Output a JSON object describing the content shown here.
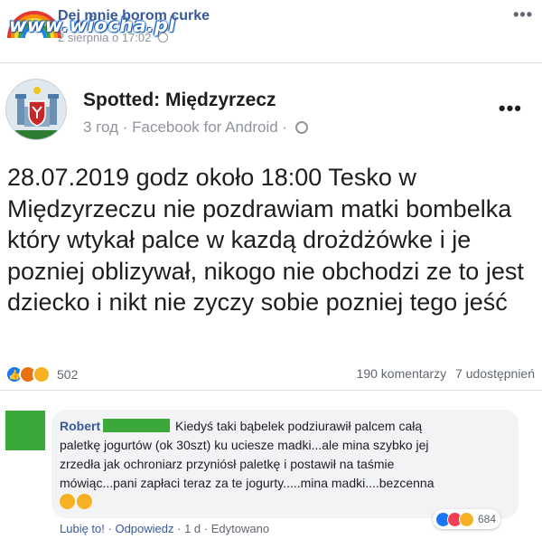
{
  "share": {
    "author": "Dej mnie borom curke",
    "date": "2 sierpnia o 17:02",
    "watermark": "www.wiocha.pl",
    "more_icon": "more-dots-icon"
  },
  "post": {
    "page_name": "Spotted: Międzyrzecz",
    "meta": "3 год · Facebook for Android ·",
    "text": "28.07.2019 godz około 18:00 Tesko w Międzyrzeczu nie pozdrawiam matki bombelka który wtykał palce w kazdą drożdżówke i je pozniej oblizywał, nikogo nie obchodzi ze to jest dziecko i nikt nie zyczy sobie pozniej tego jeść",
    "reactions_count": "502",
    "comments": "190 komentarzy",
    "shares": "7 udostępnień"
  },
  "comment": {
    "author": "Robert",
    "line1": "Kiedyś taki bąbelek podziurawił palcem całą",
    "line2": "paletkę jogurtów (ok 30szt) ku uciesze madki...ale mina szybko jej",
    "line3": "zrzedła jak ochroniarz przyniósł paletkę i postawił na taśmie",
    "line4": "mówiąc...pani zapłaci teraz za te jogurty.....mina madki....bezcenna",
    "reactions_count": "684",
    "like": "Lubię to!",
    "reply": "Odpowiedz",
    "time": "1 d",
    "edited": "Edytowano"
  },
  "colors": {
    "link": "#385898",
    "secondary_text": "#90949c",
    "like_blue": "#1877f2",
    "haha_yellow": "#f7b125",
    "censor_green": "#3aa93a"
  }
}
